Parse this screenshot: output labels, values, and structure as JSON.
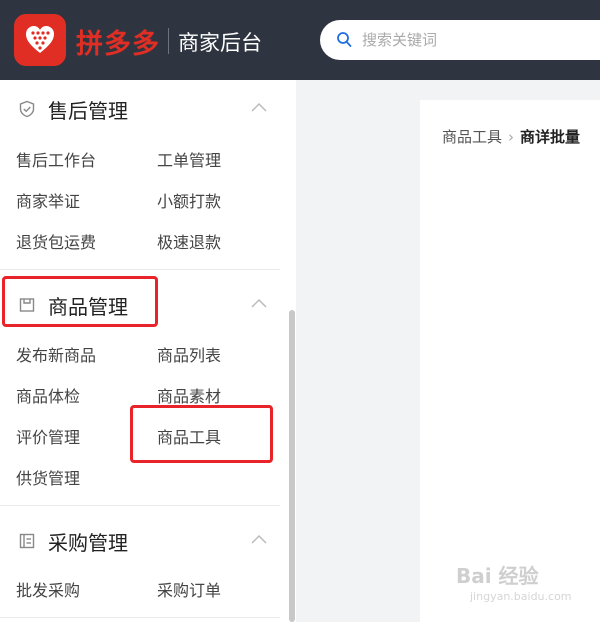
{
  "header": {
    "brand_name": "拼多多",
    "brand_sub": "商家后台",
    "search_placeholder": "搜索关键词"
  },
  "sidebar": {
    "sections": [
      {
        "title": "售后管理",
        "icon": "shield-check-icon",
        "items": [
          "售后工作台",
          "工单管理",
          "商家举证",
          "小额打款",
          "退货包运费",
          "极速退款"
        ]
      },
      {
        "title": "商品管理",
        "icon": "box-icon",
        "items": [
          "发布新商品",
          "商品列表",
          "商品体检",
          "商品素材",
          "评价管理",
          "商品工具",
          "供货管理"
        ]
      },
      {
        "title": "采购管理",
        "icon": "list-icon",
        "items": [
          "批发采购",
          "采购订单"
        ]
      }
    ]
  },
  "main": {
    "breadcrumb_root": "商品工具",
    "breadcrumb_current": "商详批量"
  },
  "watermark": {
    "text": "Bai 经验",
    "sub": "jingyan.baidu.com"
  },
  "colors": {
    "brand_red": "#e02e24",
    "topbar_bg": "#2f3540",
    "highlight": "#e8232a"
  }
}
